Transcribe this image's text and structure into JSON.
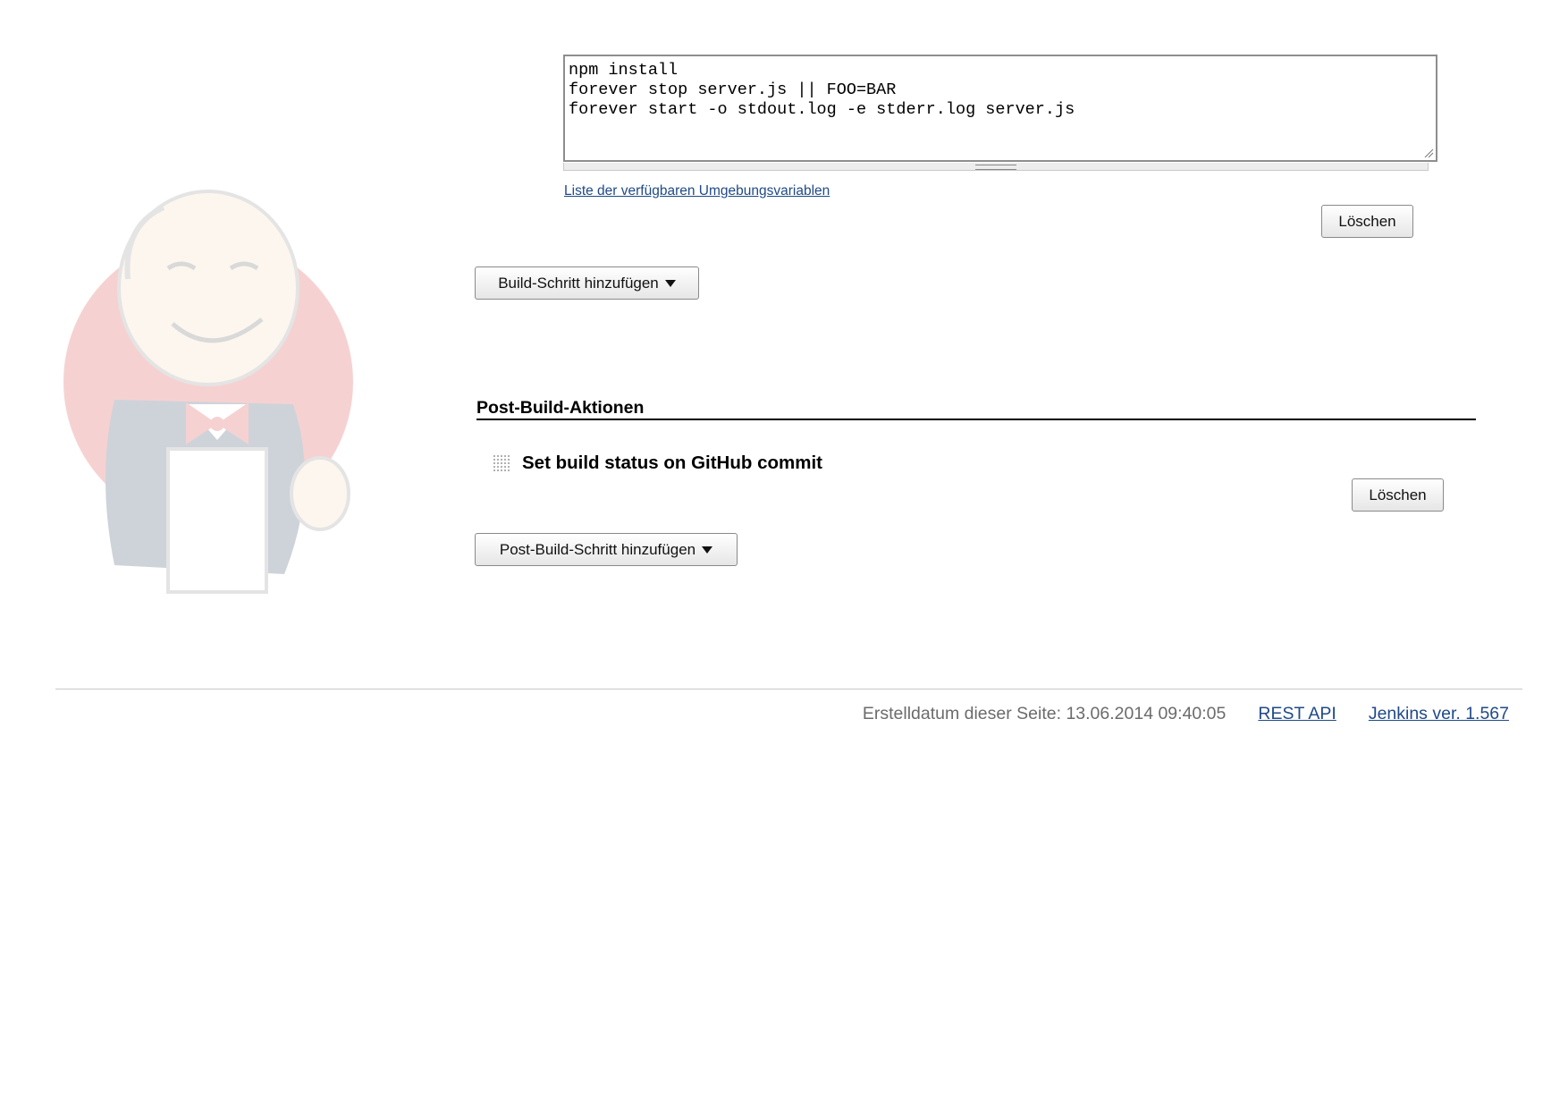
{
  "shell": {
    "command": "npm install\nforever stop server.js || FOO=BAR\nforever start -o stdout.log -e stderr.log server.js",
    "env_link": "Liste der verfügbaren Umgebungsvariablen",
    "delete_label": "Löschen"
  },
  "build": {
    "add_step_label": "Build-Schritt hinzufügen"
  },
  "post_build": {
    "section_title": "Post-Build-Aktionen",
    "actions": [
      {
        "name": "Set build status on GitHub commit",
        "delete_label": "Löschen"
      }
    ],
    "add_step_label": "Post-Build-Schritt hinzufügen"
  },
  "footer": {
    "created_text": "Erstelldatum dieser Seite: 13.06.2014 09:40:05",
    "rest_api_label": "REST API",
    "version_label": "Jenkins ver. 1.567"
  },
  "icons": {
    "mascot": "jenkins-butler-logo",
    "drag_handle": "drag-handle-icon",
    "dropdown": "caret-down-icon",
    "resize": "resize-grip-icon"
  },
  "colors": {
    "link": "#204a87",
    "mascot_red": "#d33833",
    "footer_text": "#6b6b6b"
  }
}
